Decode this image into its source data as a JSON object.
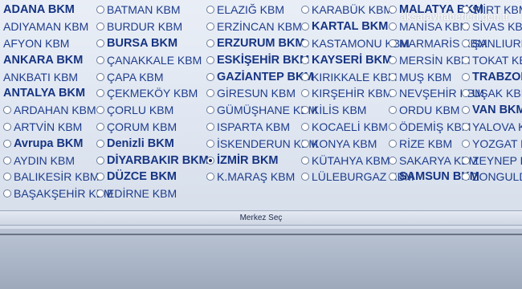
{
  "watermark": "aksarayhaberleri.gen.tr",
  "columns": [
    [
      {
        "label": "ADANA BKM",
        "bold": true,
        "radio": false
      },
      {
        "label": "ADIYAMAN KBM",
        "bold": false,
        "radio": false
      },
      {
        "label": "AFYON KBM",
        "bold": false,
        "radio": false
      },
      {
        "label": "ANKARA BKM",
        "bold": true,
        "radio": false
      },
      {
        "label": "ANKBATI KBM",
        "bold": false,
        "radio": false
      },
      {
        "label": "ANTALYA BKM",
        "bold": true,
        "radio": false
      },
      {
        "label": "ARDAHAN KBM",
        "bold": false,
        "radio": true
      },
      {
        "label": "ARTVİN KBM",
        "bold": false,
        "radio": true
      },
      {
        "label": "Avrupa BKM",
        "bold": true,
        "radio": true
      },
      {
        "label": "AYDIN KBM",
        "bold": false,
        "radio": true
      },
      {
        "label": "BALIKESİR KBM",
        "bold": false,
        "radio": true
      },
      {
        "label": "BAŞAKŞEHİR KBM",
        "bold": false,
        "radio": true
      }
    ],
    [
      {
        "label": "BATMAN KBM",
        "bold": false,
        "radio": true
      },
      {
        "label": "BURDUR KBM",
        "bold": false,
        "radio": true
      },
      {
        "label": "BURSA BKM",
        "bold": true,
        "radio": true
      },
      {
        "label": "ÇANAKKALE KBM",
        "bold": false,
        "radio": true
      },
      {
        "label": "ÇAPA KBM",
        "bold": false,
        "radio": true
      },
      {
        "label": "ÇEKMEKÖY KBM",
        "bold": false,
        "radio": true
      },
      {
        "label": "ÇORLU KBM",
        "bold": false,
        "radio": true
      },
      {
        "label": "ÇORUM KBM",
        "bold": false,
        "radio": true
      },
      {
        "label": "Denizli BKM",
        "bold": true,
        "radio": true
      },
      {
        "label": "DİYARBAKIR BKM",
        "bold": true,
        "radio": true
      },
      {
        "label": "DÜZCE BKM",
        "bold": true,
        "radio": true
      },
      {
        "label": "EDİRNE KBM",
        "bold": false,
        "radio": true
      }
    ],
    [
      {
        "label": "ELAZIĞ KBM",
        "bold": false,
        "radio": true
      },
      {
        "label": "ERZİNCAN KBM",
        "bold": false,
        "radio": true
      },
      {
        "label": "ERZURUM BKM",
        "bold": true,
        "radio": true
      },
      {
        "label": "ESKİŞEHİR BKM",
        "bold": true,
        "radio": true
      },
      {
        "label": "GAZİANTEP BKM",
        "bold": true,
        "radio": true
      },
      {
        "label": "GİRESUN KBM",
        "bold": false,
        "radio": true
      },
      {
        "label": "GÜMÜŞHANE KBM",
        "bold": false,
        "radio": true
      },
      {
        "label": "ISPARTA KBM",
        "bold": false,
        "radio": true
      },
      {
        "label": "İSKENDERUN KBM",
        "bold": false,
        "radio": true
      },
      {
        "label": "İZMİR BKM",
        "bold": true,
        "radio": true,
        "checked": true
      },
      {
        "label": "K.MARAŞ KBM",
        "bold": false,
        "radio": true
      }
    ],
    [
      {
        "label": "KARABÜK KBM",
        "bold": false,
        "radio": true
      },
      {
        "label": "KARTAL BKM",
        "bold": true,
        "radio": true
      },
      {
        "label": "KASTAMONU KBM",
        "bold": false,
        "radio": true
      },
      {
        "label": "KAYSERİ BKM",
        "bold": true,
        "radio": true
      },
      {
        "label": "KIRIKKALE KBM",
        "bold": false,
        "radio": true
      },
      {
        "label": "KIRŞEHİR KBM",
        "bold": false,
        "radio": true
      },
      {
        "label": "KİLİS KBM",
        "bold": false,
        "radio": true
      },
      {
        "label": "KOCAELİ KBM",
        "bold": false,
        "radio": true
      },
      {
        "label": "KONYA KBM",
        "bold": false,
        "radio": true
      },
      {
        "label": "KÜTAHYA KBM",
        "bold": false,
        "radio": true
      },
      {
        "label": "LÜLEBURGAZ KBM",
        "bold": false,
        "radio": true
      }
    ],
    [
      {
        "label": "MALATYA BKM",
        "bold": true,
        "radio": true
      },
      {
        "label": "MANİSA KBM",
        "bold": false,
        "radio": true
      },
      {
        "label": "MARMARİS KBM",
        "bold": false,
        "radio": true
      },
      {
        "label": "MERSİN KBM",
        "bold": false,
        "radio": true
      },
      {
        "label": "MUŞ KBM",
        "bold": false,
        "radio": true
      },
      {
        "label": "NEVŞEHİR KBM",
        "bold": false,
        "radio": true
      },
      {
        "label": "ORDU KBM",
        "bold": false,
        "radio": true
      },
      {
        "label": "ÖDEMİŞ KBM",
        "bold": false,
        "radio": true
      },
      {
        "label": "RİZE KBM",
        "bold": false,
        "radio": true
      },
      {
        "label": "SAKARYA KBM",
        "bold": false,
        "radio": true
      },
      {
        "label": "SAMSUN BKM",
        "bold": true,
        "radio": true
      }
    ],
    [
      {
        "label": "SİİRT KBM",
        "bold": false,
        "radio": true
      },
      {
        "label": "SİVAS KBM",
        "bold": false,
        "radio": true
      },
      {
        "label": "ŞANLIURFA KBM",
        "bold": false,
        "radio": true
      },
      {
        "label": "TOKAT KBM",
        "bold": false,
        "radio": true
      },
      {
        "label": "TRABZON BKM",
        "bold": true,
        "radio": true
      },
      {
        "label": "UŞAK KBM",
        "bold": false,
        "radio": true
      },
      {
        "label": "VAN BKM",
        "bold": true,
        "radio": true
      },
      {
        "label": "YALOVA KBM",
        "bold": false,
        "radio": true
      },
      {
        "label": "YOZGAT KBM",
        "bold": false,
        "radio": true
      },
      {
        "label": "ZEYNEP KAMİL KBM",
        "bold": false,
        "radio": true
      },
      {
        "label": "ZONGULDAK KBM",
        "bold": false,
        "radio": true
      }
    ]
  ],
  "submit_label": "Merkez Seç"
}
